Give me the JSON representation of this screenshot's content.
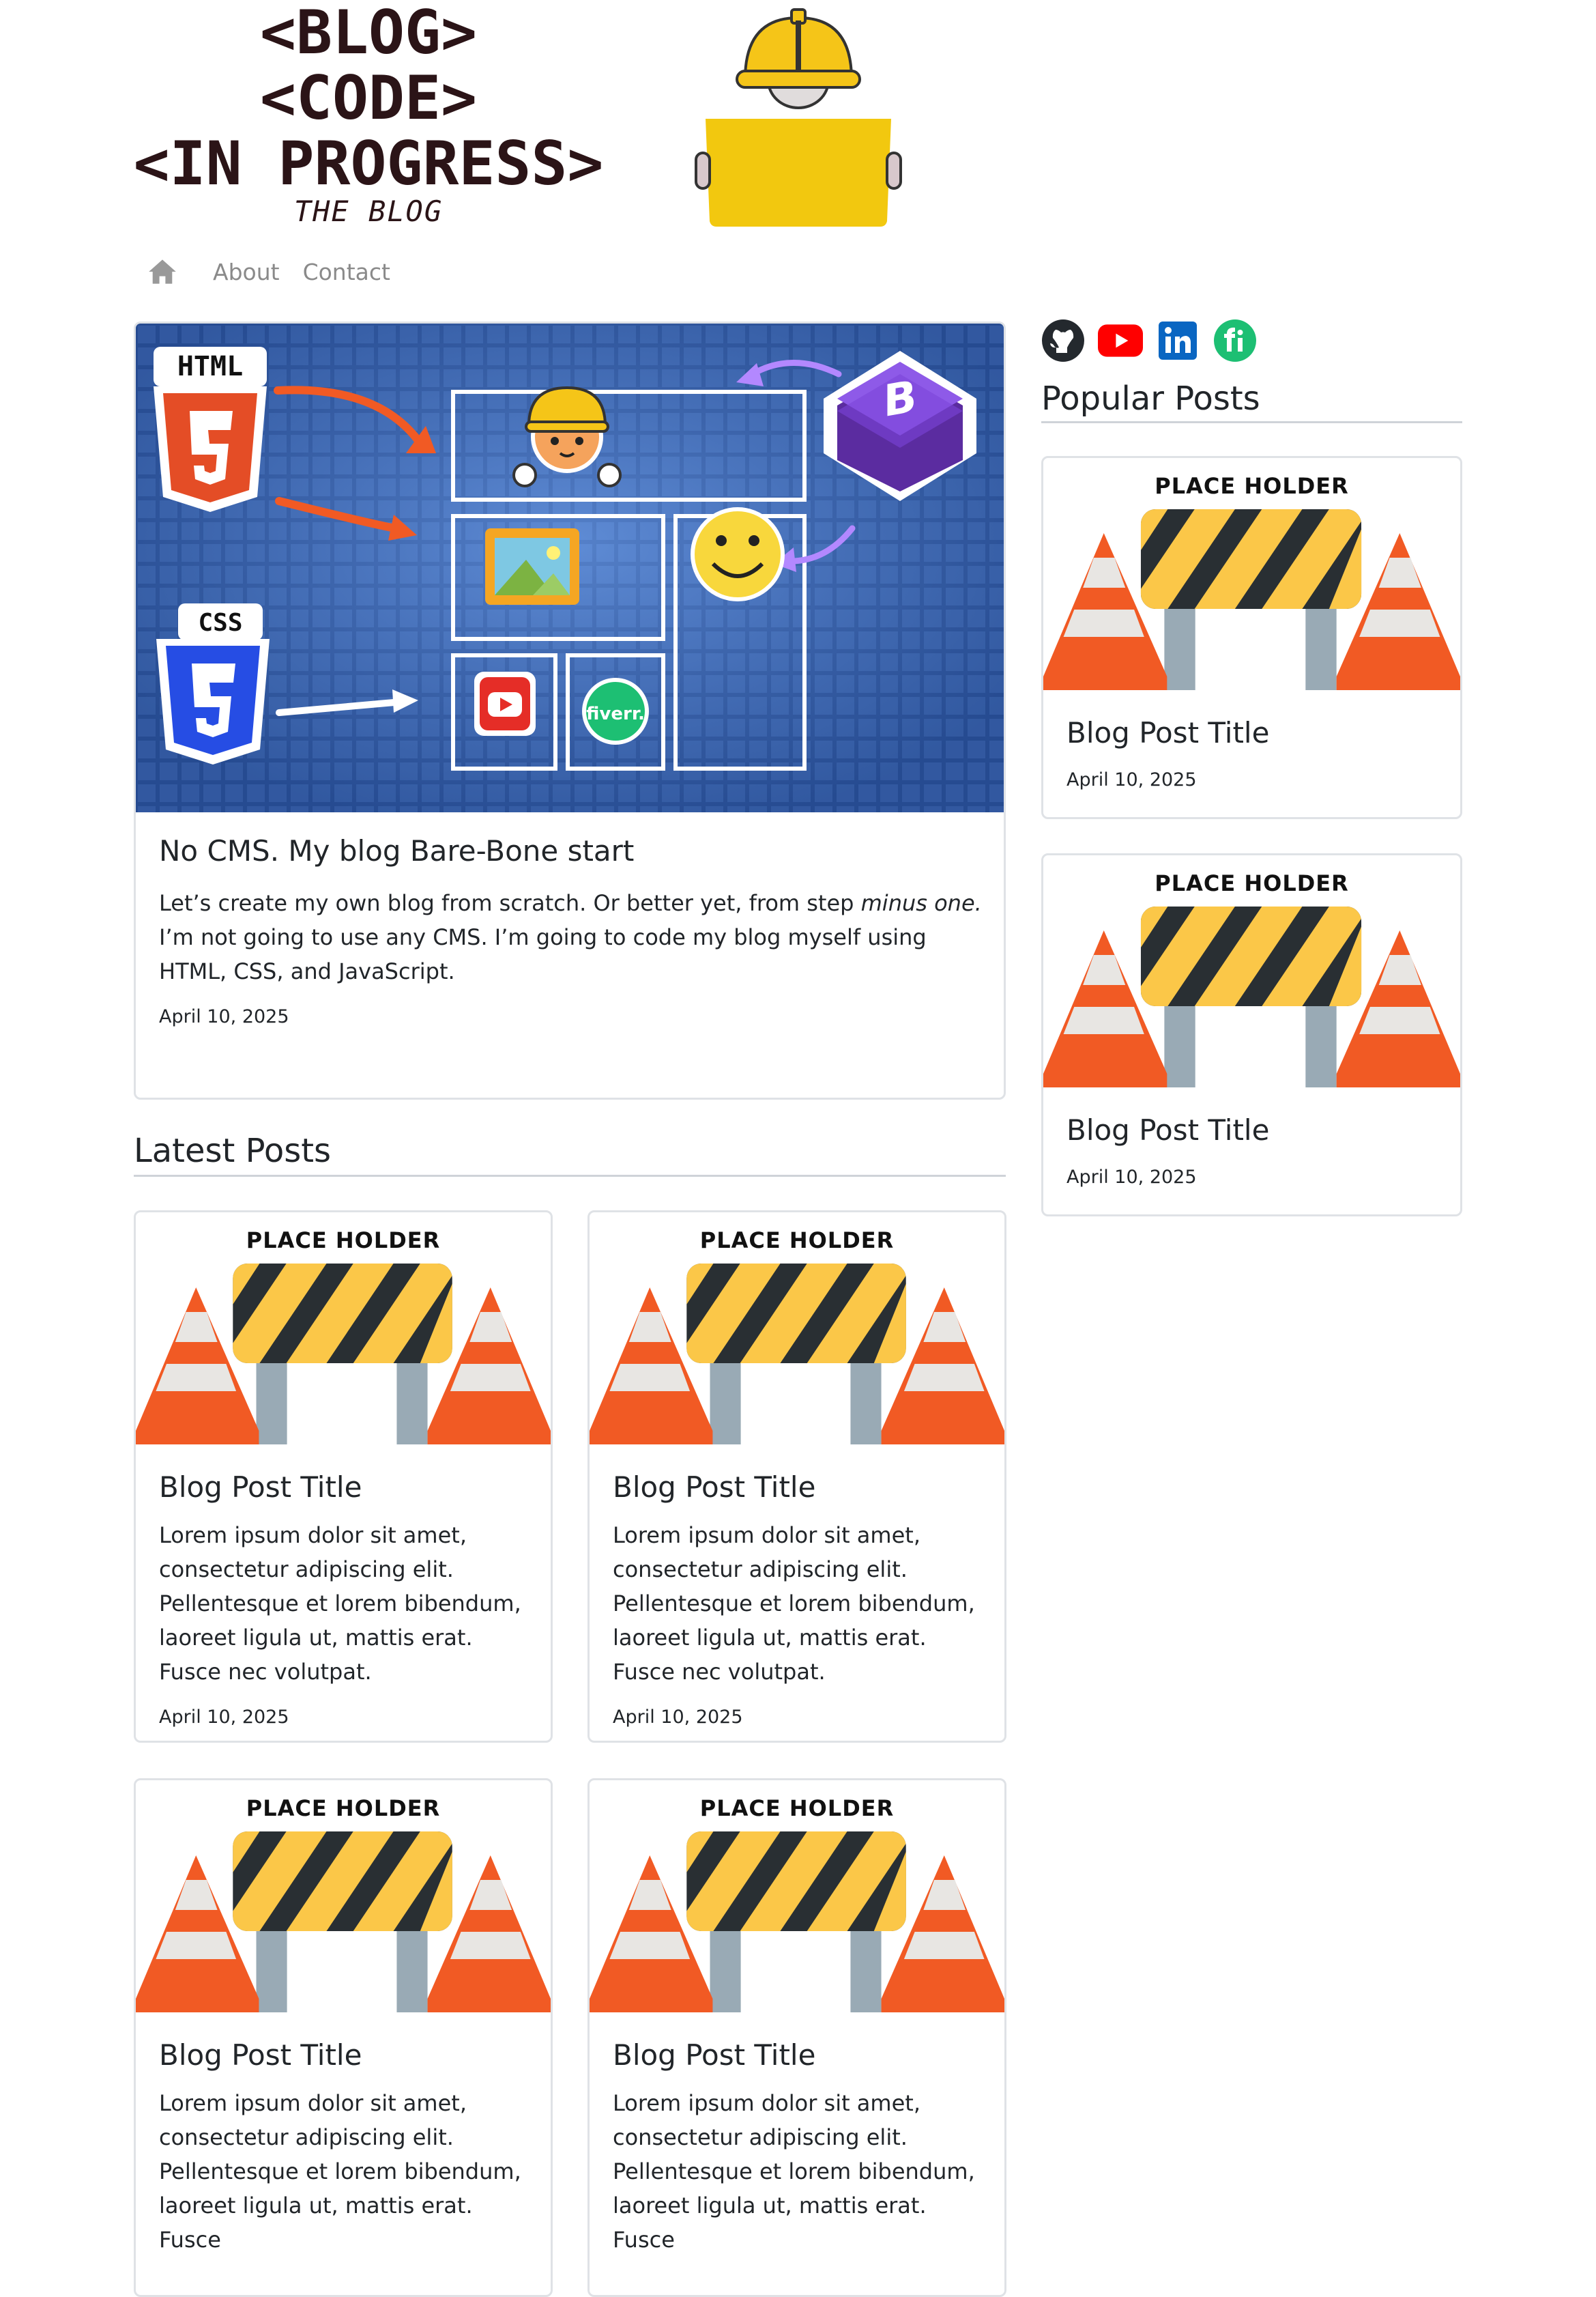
{
  "header": {
    "logo_lines": [
      "<BLOG>",
      "<CODE>",
      "<IN PROGRESS>"
    ],
    "logo_sub": "THE BLOG"
  },
  "nav": {
    "home_icon": "house-icon",
    "items": [
      {
        "label": "About"
      },
      {
        "label": "Contact"
      }
    ]
  },
  "featured": {
    "title": "No CMS. My blog Bare-Bone start",
    "text_before": "Let’s create my own blog from scratch. Or better yet, from step ",
    "text_em": "minus one.",
    "text_after": "I’m not going to use any CMS. I’m going to code my blog myself using HTML, CSS, and JavaScript.",
    "date": "April 10, 2025",
    "image_labels": {
      "html": "HTML",
      "css": "CSS",
      "fiverr": "fiverr."
    }
  },
  "latest": {
    "heading": "Latest Posts",
    "posts": [
      {
        "placeholder": "PLACE HOLDER",
        "title": "Blog Post Title",
        "text": "Lorem ipsum dolor sit amet, consectetur adipiscing elit. Pellentesque et lorem bibendum, laoreet ligula ut, mattis erat. Fusce nec volutpat.",
        "date": "April 10, 2025"
      },
      {
        "placeholder": "PLACE HOLDER",
        "title": "Blog Post Title",
        "text": "Lorem ipsum dolor sit amet, consectetur adipiscing elit. Pellentesque et lorem bibendum, laoreet ligula ut, mattis erat. Fusce nec volutpat.",
        "date": "April 10, 2025"
      },
      {
        "placeholder": "PLACE HOLDER",
        "title": "Blog Post Title",
        "text": "Lorem ipsum dolor sit amet, consectetur adipiscing elit. Pellentesque et lorem bibendum, laoreet ligula ut, mattis erat. Fusce"
      },
      {
        "placeholder": "PLACE HOLDER",
        "title": "Blog Post Title",
        "text": "Lorem ipsum dolor sit amet, consectetur adipiscing elit. Pellentesque et lorem bibendum, laoreet ligula ut, mattis erat. Fusce"
      }
    ]
  },
  "sidebar": {
    "social": [
      {
        "icon": "github-icon",
        "color": "#24292e"
      },
      {
        "icon": "youtube-icon",
        "color": "#ff0000"
      },
      {
        "icon": "linkedin-icon",
        "color": "#0a66c2"
      },
      {
        "icon": "fiverr-icon",
        "color": "#1dbf73"
      }
    ],
    "heading": "Popular Posts",
    "posts": [
      {
        "placeholder": "PLACE HOLDER",
        "title": "Blog Post Title",
        "date": "April 10, 2025"
      },
      {
        "placeholder": "PLACE HOLDER",
        "title": "Blog Post Title",
        "date": "April 10, 2025"
      }
    ]
  },
  "colors": {
    "cone": "#f15a24",
    "barrier_yellow": "#fbc748",
    "barrier_dark": "#292f33",
    "post": "#99aab5",
    "hero_bg": "#2f5aa8"
  }
}
